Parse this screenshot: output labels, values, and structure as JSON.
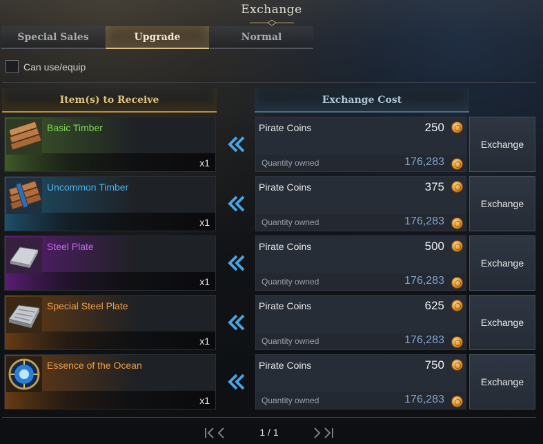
{
  "window": {
    "title": "Exchange"
  },
  "tabs": [
    {
      "label": "Special Sales",
      "active": false
    },
    {
      "label": "Upgrade",
      "active": true
    },
    {
      "label": "Normal",
      "active": false
    }
  ],
  "filter": {
    "label": "Can use/equip",
    "checked": false
  },
  "columns": {
    "receive": "Item(s) to Receive",
    "cost": "Exchange Cost"
  },
  "rows": [
    {
      "item": "Basic Timber",
      "item_color": "#7ed957",
      "glow": "#3f5a26",
      "qty": "x1",
      "icon": "basic-timber-icon",
      "cost_name": "Pirate Coins",
      "cost_amount": "250",
      "owned_label": "Quantity owned",
      "owned_value": "176,283",
      "button": "Exchange"
    },
    {
      "item": "Uncommon Timber",
      "item_color": "#4fb2e8",
      "glow": "#1d4f6a",
      "qty": "x1",
      "icon": "uncommon-timber-icon",
      "cost_name": "Pirate Coins",
      "cost_amount": "375",
      "owned_label": "Quantity owned",
      "owned_value": "176,283",
      "button": "Exchange"
    },
    {
      "item": "Steel Plate",
      "item_color": "#c46be6",
      "glow": "#5b1c75",
      "qty": "x1",
      "icon": "steel-plate-icon",
      "cost_name": "Pirate Coins",
      "cost_amount": "500",
      "owned_label": "Quantity owned",
      "owned_value": "176,283",
      "button": "Exchange"
    },
    {
      "item": "Special Steel Plate",
      "item_color": "#f0a04a",
      "glow": "#6a3c12",
      "qty": "x1",
      "icon": "special-steel-plate-icon",
      "cost_name": "Pirate Coins",
      "cost_amount": "625",
      "owned_label": "Quantity owned",
      "owned_value": "176,283",
      "button": "Exchange"
    },
    {
      "item": "Essence of the Ocean",
      "item_color": "#f0a04a",
      "glow": "#6a3c12",
      "qty": "x1",
      "icon": "essence-of-ocean-icon",
      "cost_name": "Pirate Coins",
      "cost_amount": "750",
      "owned_label": "Quantity owned",
      "owned_value": "176,283",
      "button": "Exchange"
    }
  ],
  "pager": {
    "text": "1 / 1",
    "first_icon": "page-first-icon",
    "last_icon": "page-last-icon"
  },
  "colors": {
    "accent_gold": "#d9c08a",
    "coin": "#e0952f",
    "owned_value": "#7fa4cf"
  }
}
